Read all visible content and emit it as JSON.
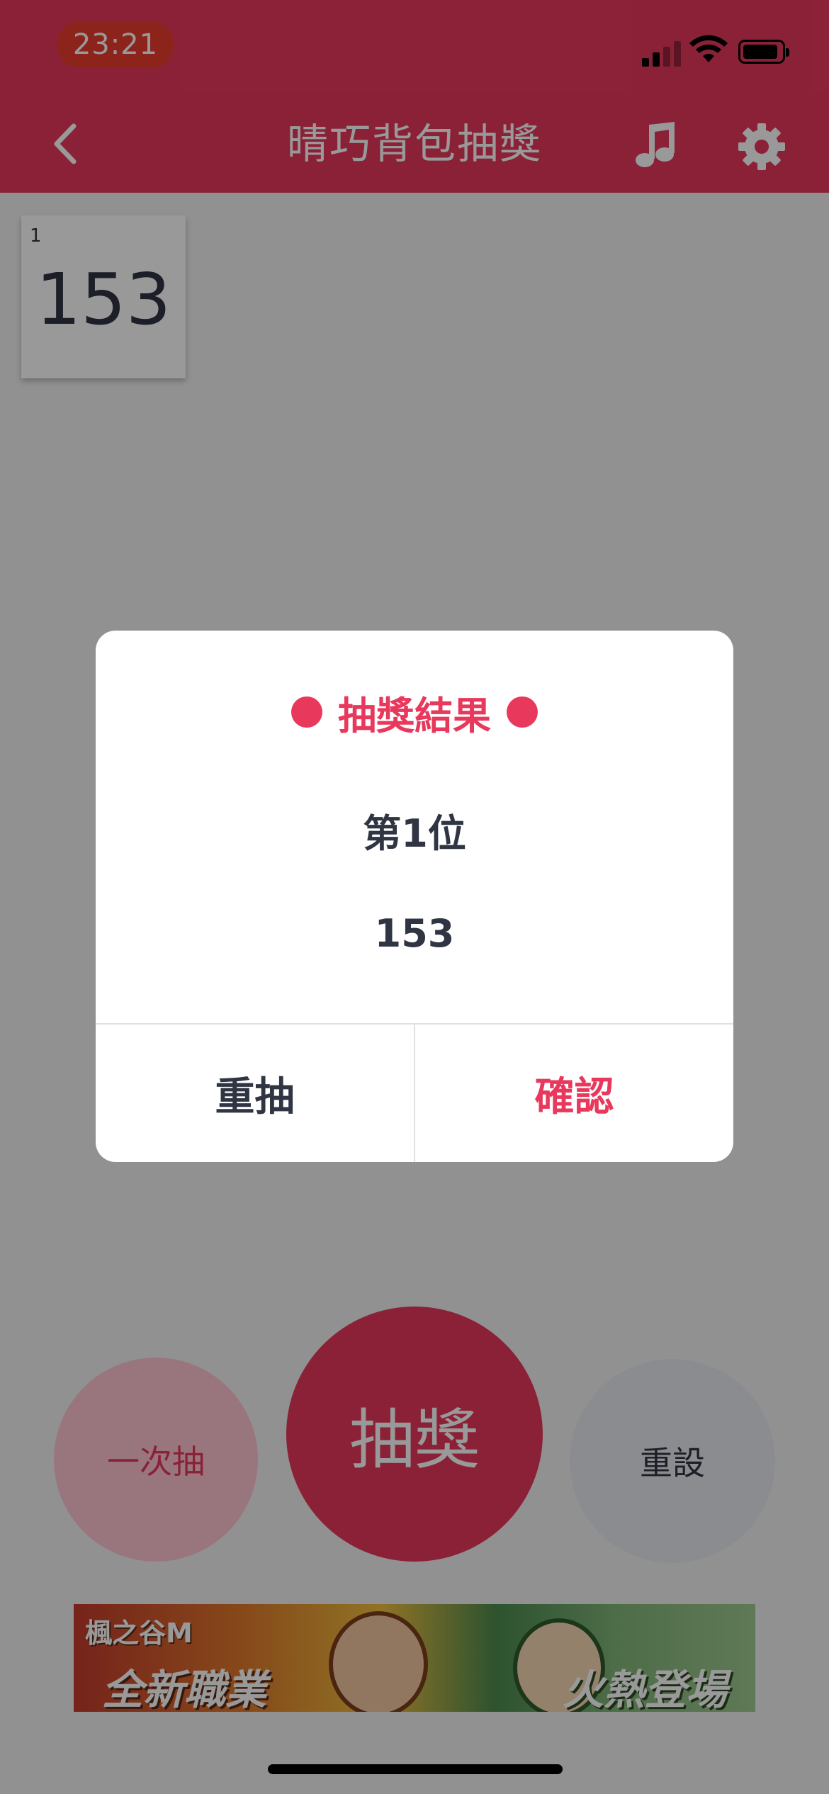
{
  "status_bar": {
    "time": "23:21",
    "icons": [
      "signal-icon",
      "wifi-icon",
      "battery-icon"
    ]
  },
  "nav": {
    "title": "晴巧背包抽獎",
    "icons": [
      "back-chevron-icon",
      "music-note-icon",
      "gear-icon"
    ]
  },
  "cards": [
    {
      "index": "1",
      "value": "153"
    }
  ],
  "actions": {
    "once_label": "一次抽",
    "draw_label": "抽獎",
    "reset_label": "重設"
  },
  "ad": {
    "logo": "楓之谷M",
    "left_text": "全新職業",
    "right_text": "火熱登場"
  },
  "dialog": {
    "title": "抽獎結果",
    "rank": "第1位",
    "result": "153",
    "redraw_label": "重抽",
    "confirm_label": "確認"
  },
  "colors": {
    "brand": "#e8385c",
    "text_dark": "#2f3542",
    "once_bg": "#ffc5d2",
    "reset_bg": "#e6eaee"
  }
}
